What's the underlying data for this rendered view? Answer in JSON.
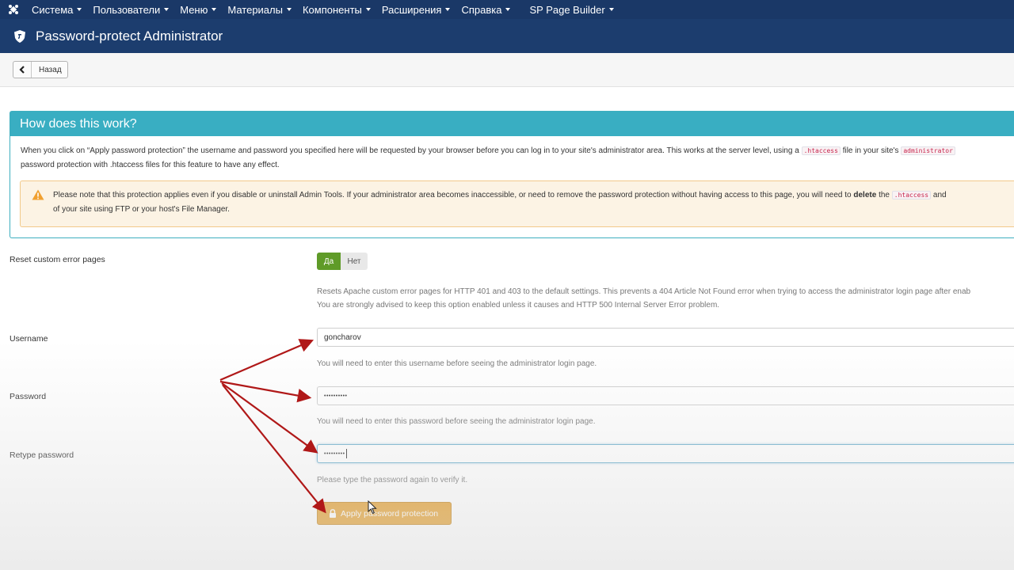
{
  "topnav": {
    "items": [
      {
        "label": "Система"
      },
      {
        "label": "Пользователи"
      },
      {
        "label": "Меню"
      },
      {
        "label": "Материалы"
      },
      {
        "label": "Компоненты"
      },
      {
        "label": "Расширения"
      },
      {
        "label": "Справка"
      },
      {
        "label": "SP Page Builder"
      }
    ]
  },
  "header": {
    "title": "Password-protect Administrator"
  },
  "toolbar": {
    "back_label": "Назад"
  },
  "info": {
    "heading": "How does this work?",
    "line1_before": "When you click on “Apply password protection” the username and password you specified here will be requested by your browser before you can log in to your site's administrator area. This works at the server level, using a",
    "line1_code": ".htaccess",
    "line1_mid": "file in your site's",
    "line1_code2": "administrator",
    "line2": "password protection with .htaccess files for this feature to have any effect.",
    "warning": {
      "line1_before": "Please note that this protection applies even if you disable or uninstall Admin Tools. If your administrator area becomes inaccessible, or need to remove the password protection without having access to this page, you will need to",
      "line1_bold": "delete",
      "line1_the": "the",
      "line1_code": ".htaccess",
      "line1_and": "and",
      "line2": "of your site using FTP or your host's File Manager."
    }
  },
  "form": {
    "reset": {
      "label": "Reset custom error pages",
      "yes": "Да",
      "no": "Нет",
      "help1": "Resets Apache custom error pages for HTTP 401 and 403 to the default settings. This prevents a 404 Article Not Found error when trying to access the administrator login page after enab",
      "help2": "You are strongly advised to keep this option enabled unless it causes and HTTP 500 Internal Server Error problem."
    },
    "username": {
      "label": "Username",
      "value": "goncharov",
      "help": "You will need to enter this username before seeing the administrator login page."
    },
    "password": {
      "label": "Password",
      "value": "••••••••••",
      "help": "You will need to enter this password before seeing the administrator login page."
    },
    "retype": {
      "label": "Retype password",
      "value": "•••••••••",
      "help": "Please type the password again to verify it."
    },
    "apply_label": "Apply password protection"
  },
  "colors": {
    "nav_bg": "#1a3867",
    "info_accent": "#39aec2",
    "yes_green": "#5f9b28",
    "apply_orange": "#e49e2a",
    "annotation_red": "#b01818"
  }
}
